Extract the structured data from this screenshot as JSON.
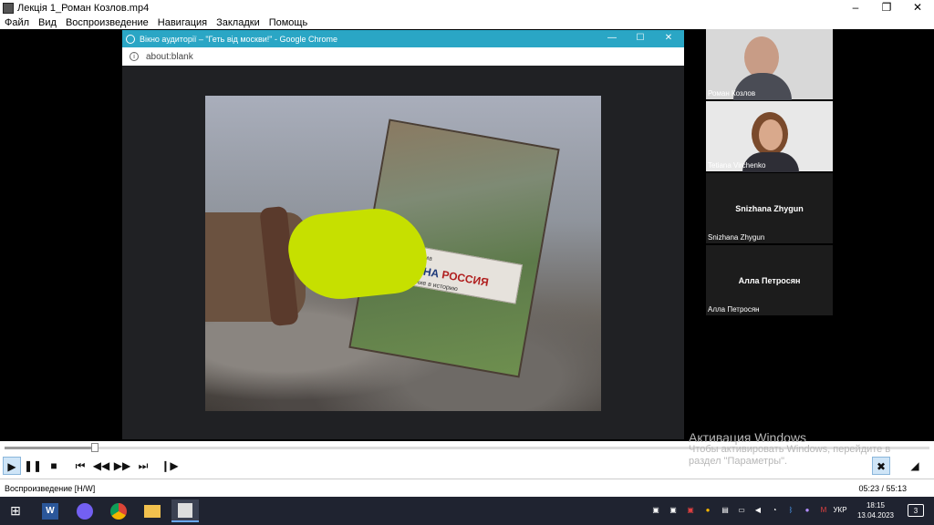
{
  "window": {
    "title": "Лекція 1_Роман Козлов.mp4",
    "minimize": "–",
    "maximize": "❐",
    "close": "✕"
  },
  "menu": [
    "Файл",
    "Вид",
    "Воспроизведение",
    "Навигация",
    "Закладки",
    "Помощь"
  ],
  "chrome": {
    "title": "Вікно аудиторії – \"Геть від москви!\" - Google Chrome",
    "url": "about:blank",
    "minimize": "—",
    "maximize": "☐",
    "close": "✕"
  },
  "photo": {
    "book_author": "Леонид Кучма",
    "book_title_1": "УКРАИНА",
    "book_title_2": "РОССИЯ",
    "book_subtitle": "Возвращение в историю"
  },
  "participants": [
    {
      "name": "Роман Козлов",
      "type": "video"
    },
    {
      "name": "Tetiana Virchenko",
      "type": "video"
    },
    {
      "name": "Snizhana Zhygun",
      "type": "avatar"
    },
    {
      "name": "Алла Петросян",
      "type": "avatar"
    }
  ],
  "watermark": {
    "title": "Активация Windows",
    "line1": "Чтобы активировать Windows, перейдите в",
    "line2": "раздел \"Параметры\"."
  },
  "status": {
    "left": "Воспроизведение [H/W]",
    "time": "05:23 / 55:13"
  },
  "playback": {
    "progress": 0.098
  },
  "taskbar": {
    "lang": "УКР",
    "time": "18:15",
    "date": "13.04.2023",
    "notifications": "3"
  },
  "colors": {
    "chrome_titlebar": "#2aa6c5",
    "glove": "#c6e000",
    "taskbar": "#1f2330"
  }
}
